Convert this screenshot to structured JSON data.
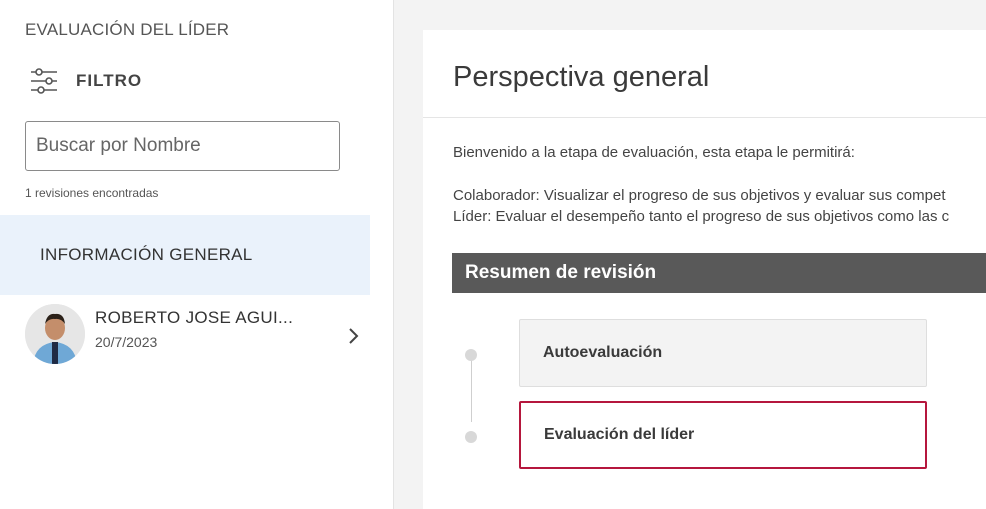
{
  "sidebar": {
    "title": "EVALUACIÓN DEL LÍDER",
    "filter_label": "FILTRO",
    "search_placeholder": "Buscar por Nombre",
    "count_text": "1 revisiones encontradas",
    "general_info": "INFORMACIÓN GENERAL",
    "person": {
      "name": "ROBERTO JOSE AGUI...",
      "date": "20/7/2023"
    }
  },
  "main": {
    "title": "Perspectiva general",
    "intro": "Bienvenido a la etapa de evaluación, esta etapa le permitirá:",
    "line1": "Colaborador: Visualizar el progreso de sus objetivos y evaluar sus compet",
    "line2": "Líder: Evaluar el desempeño tanto el progreso de sus objetivos como las c",
    "summary_title": "Resumen de revisión",
    "steps": [
      "Autoevaluación",
      "Evaluación del líder"
    ]
  },
  "colors": {
    "selected_bg": "#eaf2fb",
    "accent": "#b5173d",
    "summary_bar": "#595959"
  },
  "icons": {
    "filter": "sliders-icon",
    "chevron": "chevron-right-icon"
  }
}
